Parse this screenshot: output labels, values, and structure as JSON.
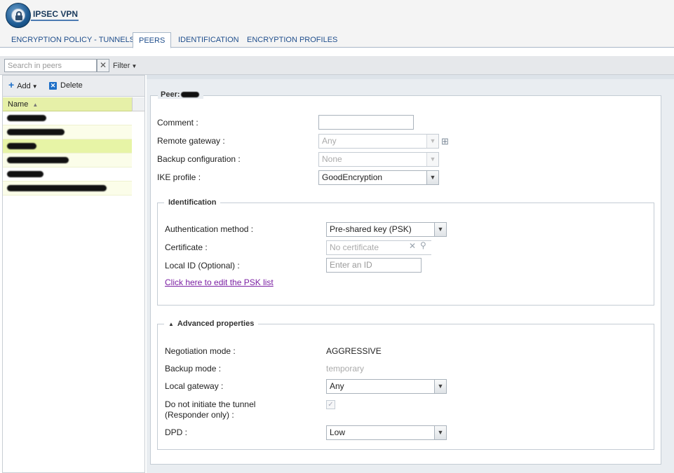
{
  "header": {
    "title": "IPSEC VPN",
    "icon": "vpn-lock-icon"
  },
  "tabs": [
    {
      "label": "ENCRYPTION POLICY - TUNNELS",
      "active": false
    },
    {
      "label": "PEERS",
      "active": true
    },
    {
      "label": "IDENTIFICATION",
      "active": false
    },
    {
      "label": "ENCRYPTION PROFILES",
      "active": false
    }
  ],
  "toolbar": {
    "search_placeholder": "Search in peers",
    "filter_label": "Filter"
  },
  "peers_list": {
    "add_label": "Add",
    "delete_label": "Delete",
    "column_name": "Name",
    "row_count": 6,
    "selected_row": 3
  },
  "peer_form": {
    "legend": "Peer:",
    "comment_label": "Comment :",
    "comment_value": "",
    "remote_gateway_label": "Remote gateway :",
    "remote_gateway_value": "Any",
    "backup_config_label": "Backup configuration :",
    "backup_config_value": "None",
    "ike_profile_label": "IKE profile :",
    "ike_profile_value": "GoodEncryption"
  },
  "identification": {
    "legend": "Identification",
    "auth_method_label": "Authentication method :",
    "auth_method_value": "Pre-shared key (PSK)",
    "certificate_label": "Certificate :",
    "certificate_placeholder": "No certificate",
    "local_id_label": "Local ID (Optional) :",
    "local_id_placeholder": "Enter an ID",
    "psk_link": "Click here to edit the PSK list"
  },
  "advanced": {
    "legend": "Advanced properties",
    "negotiation_mode_label": "Negotiation mode :",
    "negotiation_mode_value": "AGGRESSIVE",
    "backup_mode_label": "Backup mode :",
    "backup_mode_value": "temporary",
    "local_gateway_label": "Local gateway :",
    "local_gateway_value": "Any",
    "responder_label_1": "Do not initiate the tunnel",
    "responder_label_2": "(Responder only) :",
    "responder_checked": true,
    "dpd_label": "DPD :",
    "dpd_value": "Low"
  },
  "colors": {
    "accent": "#1f4e8c",
    "selected_row": "#e7f4a6",
    "link": "#7a1fa2"
  }
}
